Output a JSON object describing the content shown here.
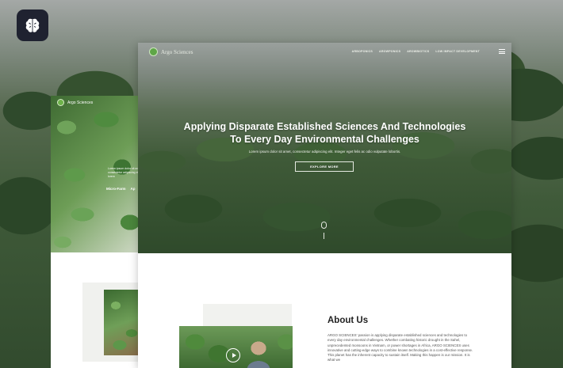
{
  "front": {
    "brand": "Argo Sciences",
    "menu": [
      "ARBOPONICS",
      "AROWPONICS",
      "AROWBIOTICS",
      "LOW IMPACT DEVELOPMENT"
    ],
    "hero_title_line1": "Applying Disparate Established Sciences And Technologies",
    "hero_title_line2": "To Every Day Environmental Challenges",
    "hero_sub": "Lorem ipsum dolor sit amet, consectetur adipiscing elit. Integer eget felis ac odio vulputate lobortis.",
    "explore_label": "EXPLORE MORE",
    "about_title": "About Us",
    "about_text": "ARGO SCIENCES' passion is applying disparate established sciences and technologies to every day environmental challenges. Whether combating historic drought in the Sahel, unprecedented monsoons in Vietnam, or power shortages in Africa, ARGO SCIENCES uses innovative and cutting-edge ways to combine known technologies in a cost-effective response. This planet has the inherent capacity to sustain itself. Making this happen is our mission. It is what we"
  },
  "back": {
    "brand": "Argo Sciences",
    "hero_text": "Lorem ipsum dolor sit amet consectetur adipiscing elit lorem",
    "tabs": [
      "Micro-Farm",
      "Ap"
    ]
  },
  "icons": {
    "app_logo": "brain-icon",
    "menu": "hamburger-icon",
    "play": "play-icon",
    "scroll": "mouse-scroll-icon"
  },
  "colors": {
    "badge_bg": "#1f2230",
    "brand_green": "#5fa647"
  }
}
